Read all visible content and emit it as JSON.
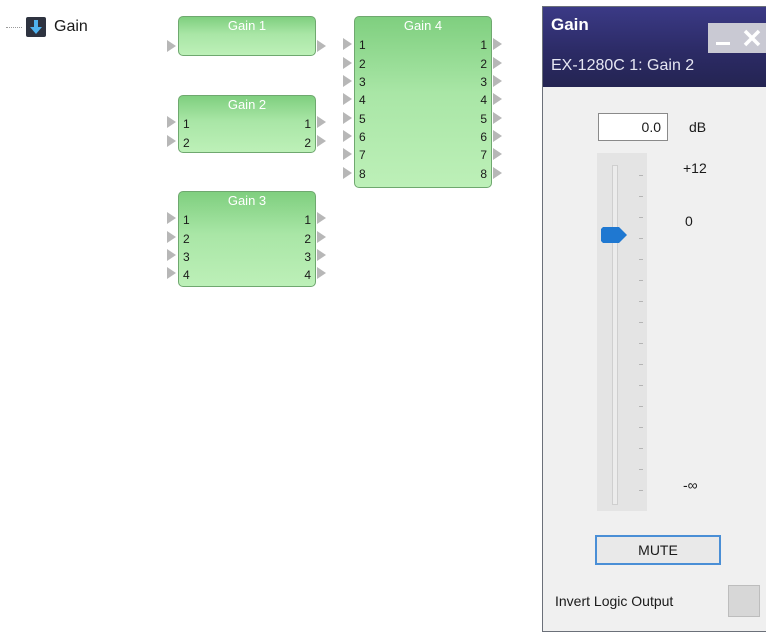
{
  "tree": {
    "label": "Gain",
    "icon": "down-arrow-icon"
  },
  "blocks": [
    {
      "title": "Gain 1",
      "inputs": [],
      "outputs": []
    },
    {
      "title": "Gain 2",
      "inputs": [
        "1",
        "2"
      ],
      "outputs": [
        "1",
        "2"
      ]
    },
    {
      "title": "Gain 3",
      "inputs": [
        "1",
        "2",
        "3",
        "4"
      ],
      "outputs": [
        "1",
        "2",
        "3",
        "4"
      ]
    },
    {
      "title": "Gain 4",
      "inputs": [
        "1",
        "2",
        "3",
        "4",
        "5",
        "6",
        "7",
        "8"
      ],
      "outputs": [
        "1",
        "2",
        "3",
        "4",
        "5",
        "6",
        "7",
        "8"
      ]
    }
  ],
  "panel": {
    "title": "Gain",
    "subtitle": "EX-1280C 1: Gain 2",
    "minimize_icon": "minimize-icon",
    "close_icon": "close-icon",
    "level_value": "0.0",
    "level_unit": "dB",
    "fader": {
      "max_label": "+12",
      "zero_label": "0",
      "min_label": "-∞",
      "value_db": 0
    },
    "mute_label": "MUTE",
    "invert_label": "Invert Logic Output",
    "invert_checked": false
  },
  "colors": {
    "block_green": "#a9e6a6",
    "panel_header": "#2c2b66",
    "accent_blue": "#1f78d1"
  }
}
